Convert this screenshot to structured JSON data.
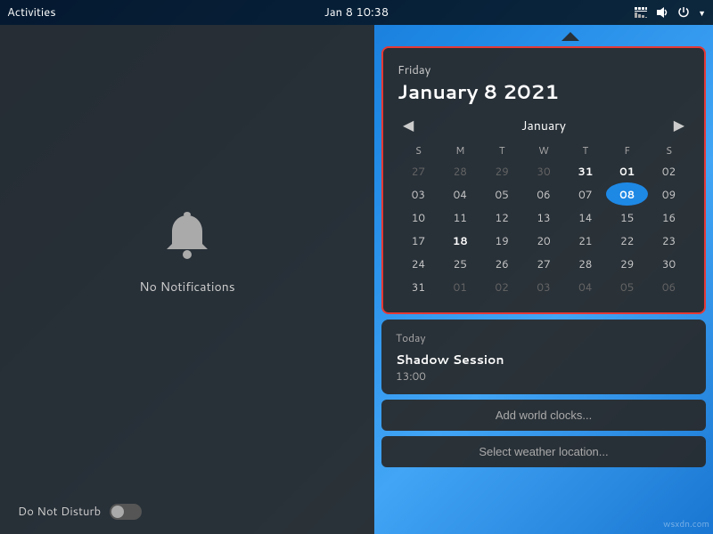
{
  "topbar": {
    "activities_label": "Activities",
    "datetime": "Jan 8  10:38",
    "icons": [
      "network-icon",
      "volume-icon",
      "power-icon"
    ]
  },
  "notifications": {
    "no_notifications_text": "No Notifications",
    "dnd_label": "Do Not Disturb",
    "dnd_on": false
  },
  "calendar": {
    "day_name": "Friday",
    "full_date": "January 8 2021",
    "month_label": "January",
    "weekdays": [
      "S",
      "M",
      "T",
      "W",
      "T",
      "F",
      "S"
    ],
    "weeks": [
      [
        "27",
        "28",
        "29",
        "30",
        "31",
        "01",
        "02"
      ],
      [
        "03",
        "04",
        "05",
        "06",
        "07",
        "08",
        "09"
      ],
      [
        "10",
        "11",
        "12",
        "13",
        "14",
        "15",
        "16"
      ],
      [
        "17",
        "18",
        "19",
        "20",
        "21",
        "22",
        "23"
      ],
      [
        "24",
        "25",
        "26",
        "27",
        "28",
        "29",
        "30"
      ],
      [
        "31",
        "01",
        "02",
        "03",
        "04",
        "05",
        "06"
      ]
    ],
    "today_cell": [
      1,
      5
    ],
    "bold_cells": {
      "0_4": true,
      "0_5": true,
      "3_1": true
    },
    "other_month_cells": {
      "0_0": true,
      "0_1": true,
      "0_2": true,
      "0_3": true,
      "5_1": true,
      "5_2": true,
      "5_3": true,
      "5_4": true,
      "5_5": true,
      "5_6": true
    }
  },
  "today_events": {
    "section_label": "Today",
    "events": [
      {
        "title": "Shadow Session",
        "time": "13:00"
      }
    ]
  },
  "actions": {
    "add_world_clocks": "Add world clocks...",
    "select_weather": "Select weather location..."
  },
  "watermark": "wsxdn.com"
}
